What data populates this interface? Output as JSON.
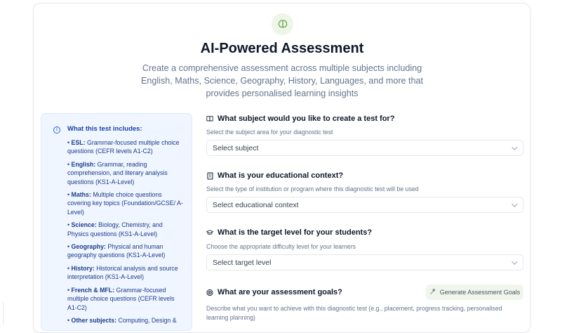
{
  "header": {
    "icon": "brain-icon",
    "title": "AI-Powered Assessment",
    "subtitle": "Create a comprehensive assessment across multiple subjects including English, Maths, Science, Geography, History, Languages, and more that provides personalised learning insights"
  },
  "info": {
    "title": "What this test includes:",
    "items": [
      {
        "label": "ESL:",
        "text": " Grammar-focused multiple choice questions (CEFR levels A1-C2)"
      },
      {
        "label": "English:",
        "text": " Grammar, reading comprehension, and literary analysis questions (KS1-A-Level)"
      },
      {
        "label": "Maths:",
        "text": " Multiple choice questions covering key topics (Foundation/GCSE/ A-Level)"
      },
      {
        "label": "Science:",
        "text": " Biology, Chemistry, and Physics questions (KS1-A-Level)"
      },
      {
        "label": "Geography:",
        "text": " Physical and human geography questions (KS1-A-Level)"
      },
      {
        "label": "History:",
        "text": " Historical analysis and source interpretation (KS1-A-Level)"
      },
      {
        "label": "French & MFL:",
        "text": " Grammar-focused multiple choice questions (CEFR levels A1-C2)"
      },
      {
        "label": "Other subjects:",
        "text": " Computing, Design &"
      }
    ]
  },
  "questions": {
    "subject": {
      "title": "What subject would you like to create a test for?",
      "hint": "Select the subject area for your diagnostic test",
      "placeholder": "Select subject",
      "icon": "book-icon"
    },
    "context": {
      "title": "What is your educational context?",
      "hint": "Select the type of institution or program where this diagnostic test will be used",
      "placeholder": "Select educational context",
      "icon": "building-icon"
    },
    "level": {
      "title": "What is the target level for your students?",
      "hint": "Choose the appropriate difficulty level for your learners",
      "placeholder": "Select target level",
      "icon": "graduation-cap-icon"
    },
    "goals": {
      "title": "What are your assessment goals?",
      "hint": "Describe what you want to achieve with this diagnostic test (e.g., placement, progress tracking, personalised learning planning)",
      "icon": "target-icon",
      "button": "Generate Assessment Goals",
      "button_icon": "wand-icon"
    }
  }
}
